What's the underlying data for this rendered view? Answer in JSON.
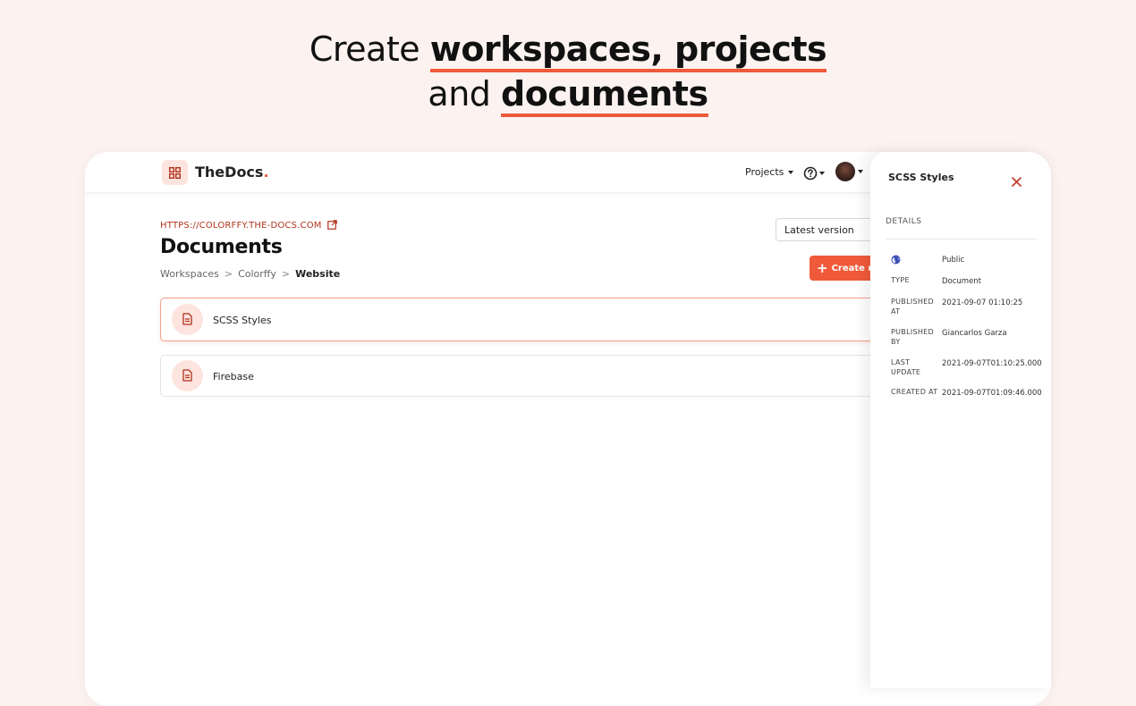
{
  "hero": {
    "line1_light": "Create",
    "line1_bold": "workspaces, projects",
    "line2_light": "and",
    "line2_bold": "documents"
  },
  "app": {
    "brand": "TheDocs",
    "brand_dot": ".",
    "nav": {
      "projects_label": "Projects"
    },
    "url": "HTTPS://COLORFFY.THE-DOCS.COM",
    "page_title": "Documents",
    "breadcrumb": [
      "Workspaces",
      "Colorffy",
      "Website"
    ],
    "breadcrumb_sep": ">",
    "version_select": "Latest version",
    "create_button": "Create n",
    "create_plus": "+",
    "documents": [
      {
        "name": "SCSS Styles",
        "active": true
      },
      {
        "name": "Firebase",
        "active": false
      }
    ]
  },
  "drawer": {
    "title": "SCSS Styles",
    "section_label": "DETAILS",
    "visibility": "Public",
    "fields": [
      {
        "key": "TYPE",
        "value": "Document"
      },
      {
        "key": "PUBLISHED AT",
        "value": "2021-09-07 01:10:25"
      },
      {
        "key": "PUBLISHED BY",
        "value": "Giancarlos Garza"
      },
      {
        "key": "LAST UPDATE",
        "value": "2021-09-07T01:10:25.000"
      },
      {
        "key": "CREATED AT",
        "value": "2021-09-07T01:09:46.000"
      }
    ]
  },
  "colors": {
    "accent": "#f05a3a",
    "accent_soft": "#fde4de",
    "background": "#fcf3f1",
    "link": "#b0331c"
  },
  "icons": [
    "grid-icon",
    "help-icon",
    "external-link-icon",
    "document-icon",
    "globe-icon",
    "close-icon"
  ]
}
